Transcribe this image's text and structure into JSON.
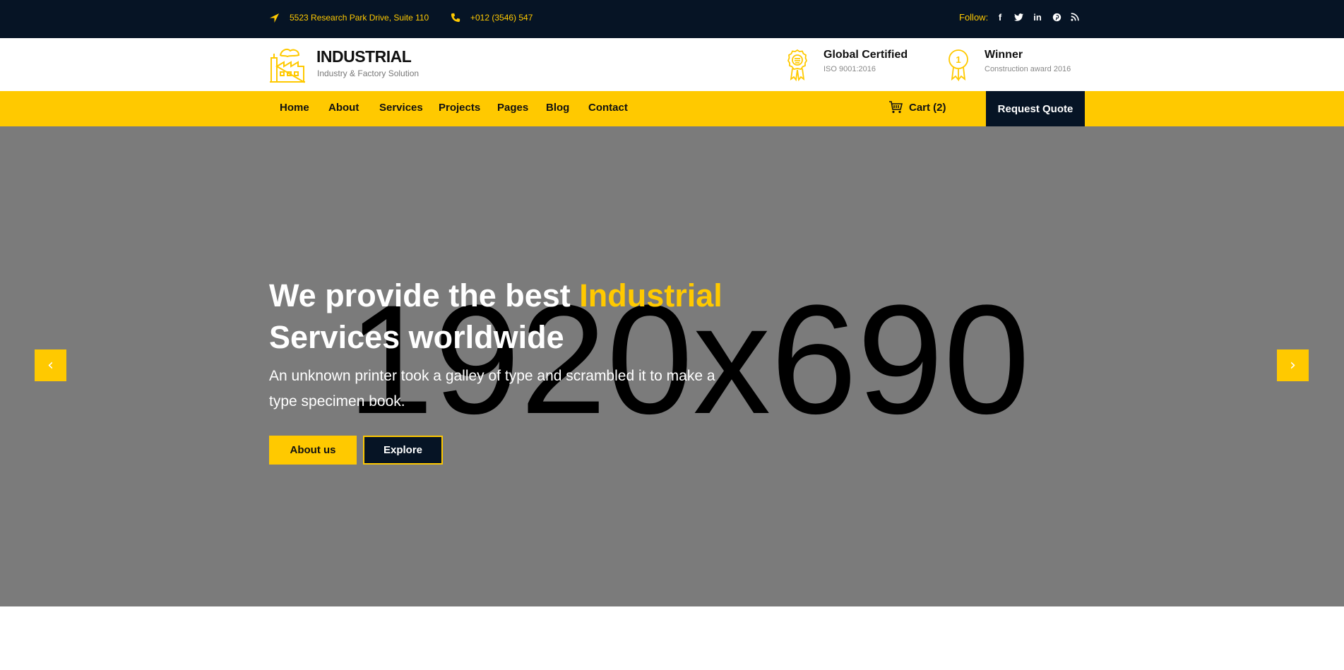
{
  "colors": {
    "dark": "#061425",
    "accent": "#ffc900",
    "hero_bg": "#7b7b7b"
  },
  "topbar": {
    "address_icon": "location-arrow-icon",
    "address": "5523 Research Park Drive, Suite 110",
    "phone_icon": "phone-icon",
    "phone": "+012 (3546) 547",
    "follow_label": "Follow:",
    "social": [
      {
        "icon": "facebook-icon",
        "glyph": "f"
      },
      {
        "icon": "twitter-icon",
        "glyph": "🐦"
      },
      {
        "icon": "linkedin-icon",
        "glyph": "in"
      },
      {
        "icon": "pinterest-icon",
        "glyph": "℗"
      },
      {
        "icon": "rss-icon",
        "glyph": "☰"
      }
    ]
  },
  "header": {
    "logo_icon": "factory-icon",
    "logo_title": "INDUSTRIAL",
    "logo_subtitle": "Industry & Factory Solution",
    "awards": [
      {
        "icon": "certificate-badge-icon",
        "title": "Global Certified",
        "subtitle": "ISO 9001:2016"
      },
      {
        "icon": "medal-icon",
        "medal_number": "1",
        "title": "Winner",
        "subtitle": "Construction award 2016"
      }
    ]
  },
  "nav": {
    "items": [
      "Home",
      "About",
      "Services",
      "Projects",
      "Pages",
      "Blog",
      "Contact"
    ],
    "cart_icon": "cart-icon",
    "cart_label": "Cart (2)",
    "quote_label": "Request Quote"
  },
  "hero": {
    "placeholder_text": "1920x690",
    "title_part1": "We provide the best ",
    "title_highlight": "Industrial",
    "title_part2": "Services worldwide",
    "text": "An unknown printer took a galley of type and scrambled it to make a type specimen book.",
    "primary_button": "About us",
    "secondary_button": "Explore",
    "prev_icon": "chevron-left-icon",
    "prev_glyph": "‹",
    "next_icon": "chevron-right-icon",
    "next_glyph": "›"
  }
}
